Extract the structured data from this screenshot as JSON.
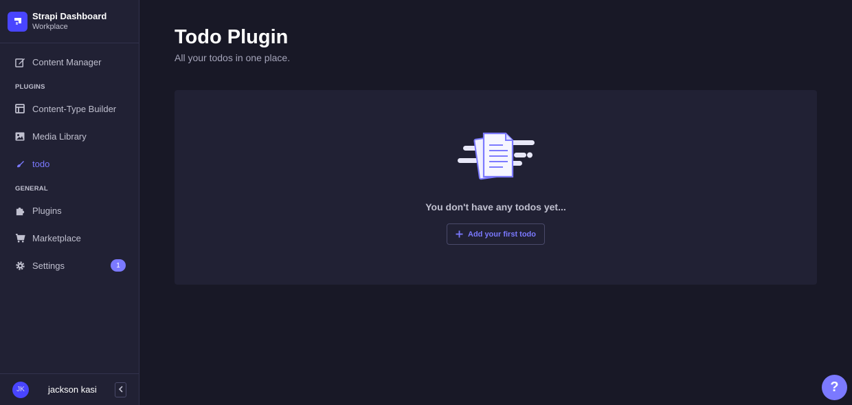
{
  "brand": {
    "title": "Strapi Dashboard",
    "subtitle": "Workplace",
    "logo_icon": "strapi-logo",
    "accent": "#4945ff"
  },
  "sidebar": {
    "top_items": [
      {
        "label": "Content Manager",
        "icon": "pen-icon"
      }
    ],
    "sections": [
      {
        "title": "PLUGINS",
        "items": [
          {
            "label": "Content-Type Builder",
            "icon": "layout-icon"
          },
          {
            "label": "Media Library",
            "icon": "image-icon"
          },
          {
            "label": "todo",
            "icon": "brush-icon",
            "active": true
          }
        ]
      },
      {
        "title": "GENERAL",
        "items": [
          {
            "label": "Plugins",
            "icon": "puzzle-icon"
          },
          {
            "label": "Marketplace",
            "icon": "cart-icon"
          },
          {
            "label": "Settings",
            "icon": "gear-icon",
            "badge": "1"
          }
        ]
      }
    ],
    "footer": {
      "avatar_initials": "JK",
      "user_name": "jackson kasi",
      "collapse_icon": "chevron-left-icon"
    }
  },
  "main": {
    "title": "Todo Plugin",
    "subtitle": "All your todos in one place.",
    "empty_state": {
      "message": "You don't have any todos yet...",
      "button_label": "Add your first todo",
      "illustration": "documents-illustration"
    }
  },
  "help_button": {
    "label": "?"
  },
  "colors": {
    "background": "#181826",
    "sidebar": "#212134",
    "active": "#7b79ff",
    "muted_text": "#c0c0cf"
  }
}
